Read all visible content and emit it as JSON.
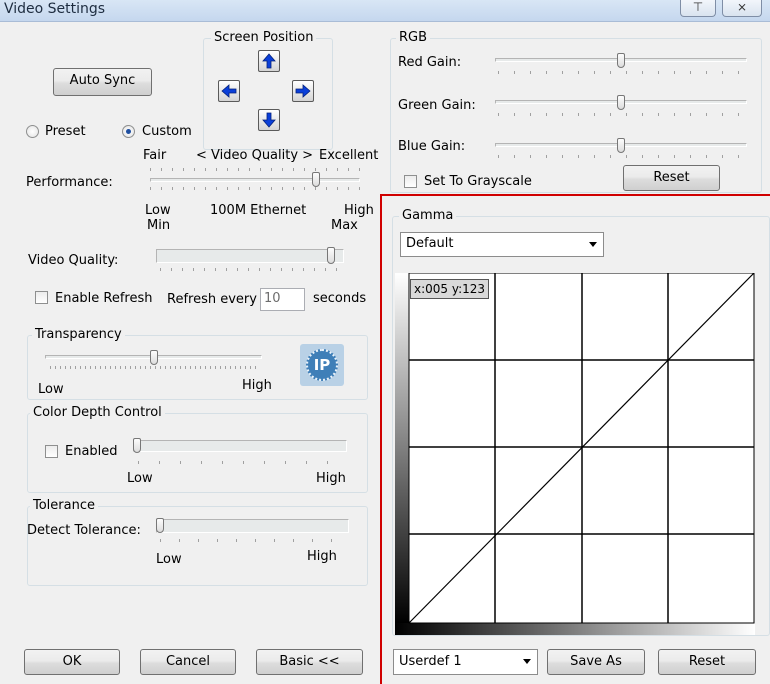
{
  "window": {
    "title": "Video Settings",
    "pin_glyph": "⊤",
    "close_glyph": "⨯"
  },
  "auto_sync_label": "Auto Sync",
  "screen_position": {
    "title": "Screen Position",
    "icons": [
      "arrow-up-icon",
      "arrow-left-icon",
      "arrow-right-icon",
      "arrow-down-icon"
    ]
  },
  "mode": {
    "preset_label": "Preset",
    "custom_label": "Custom",
    "selected": "Custom"
  },
  "performance": {
    "fair_label": "Fair",
    "quality_label": "< Video Quality >",
    "excellent_label": "Excellent",
    "label": "Performance:",
    "low_label": "Low",
    "min_label": "Min",
    "ethernet_label": "100M Ethernet",
    "high_label": "High",
    "max_label": "Max",
    "level": 0.8
  },
  "video_quality": {
    "label": "Video Quality:",
    "level": 0.95
  },
  "refresh": {
    "enable_label": "Enable Refresh",
    "every_label": "Refresh every",
    "value": "10",
    "seconds_label": "seconds",
    "checked": false
  },
  "transparency": {
    "title": "Transparency",
    "low_label": "Low",
    "high_label": "High",
    "logo_text": "IP",
    "level": 0.5
  },
  "color_depth": {
    "title": "Color Depth Control",
    "enabled_label": "Enabled",
    "low_label": "Low",
    "high_label": "High",
    "checked": false,
    "level": 0
  },
  "tolerance": {
    "title": "Tolerance",
    "detect_label": "Detect Tolerance:",
    "low_label": "Low",
    "high_label": "High",
    "level": 0
  },
  "footer": {
    "ok_label": "OK",
    "cancel_label": "Cancel",
    "basic_label": "Basic <<"
  },
  "rgb": {
    "title": "RGB",
    "red_label": "Red Gain:",
    "green_label": "Green Gain:",
    "blue_label": "Blue Gain:",
    "red_level": 0.5,
    "green_level": 0.5,
    "blue_level": 0.5,
    "grayscale_label": "Set To Grayscale",
    "grayscale_checked": false,
    "reset_label": "Reset"
  },
  "gamma": {
    "title": "Gamma",
    "preset_value": "Default",
    "coord_readout": "x:005 y:123",
    "userdef_value": "Userdef 1",
    "save_as_label": "Save As",
    "reset_label": "Reset",
    "highlight_color": "#d00000"
  }
}
